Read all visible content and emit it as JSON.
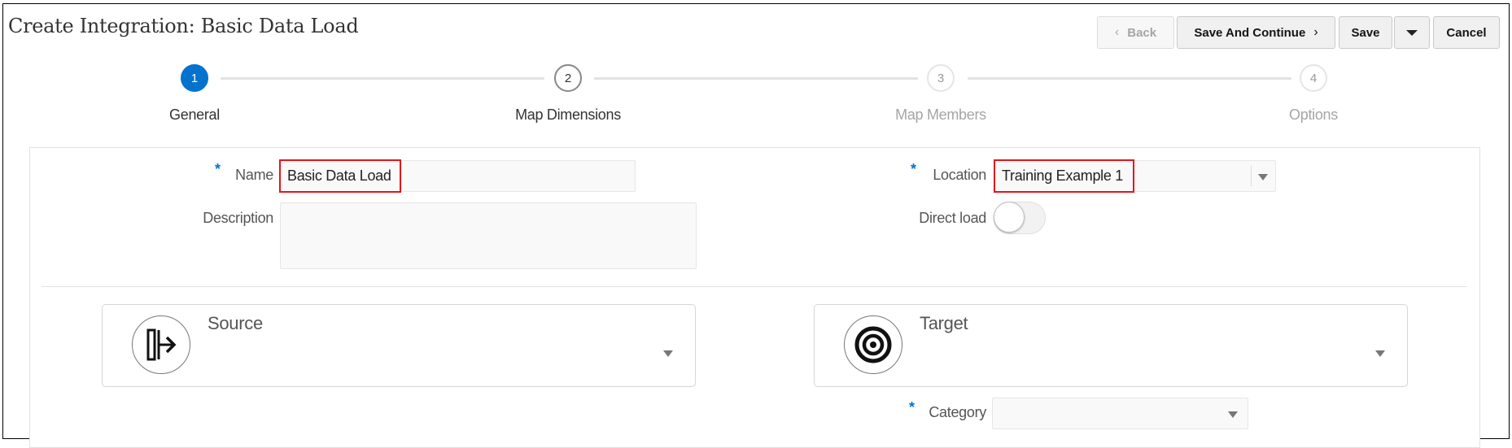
{
  "header": {
    "title": "Create Integration: Basic Data Load"
  },
  "toolbar": {
    "back_label": "Back",
    "back_chevron": "‹",
    "save_continue_label": "Save And Continue",
    "save_continue_chevron": "›",
    "save_label": "Save",
    "cancel_label": "Cancel"
  },
  "train": {
    "steps": [
      {
        "number": "1",
        "label": "General",
        "state": "active"
      },
      {
        "number": "2",
        "label": "Map Dimensions",
        "state": "visited"
      },
      {
        "number": "3",
        "label": "Map Members",
        "state": "future"
      },
      {
        "number": "4",
        "label": "Options",
        "state": "future"
      }
    ]
  },
  "form": {
    "required_marker": "*",
    "name": {
      "label": "Name",
      "value": "Basic Data Load"
    },
    "description": {
      "label": "Description",
      "value": ""
    },
    "location": {
      "label": "Location",
      "value": "Training Example 1"
    },
    "direct_load": {
      "label": "Direct load",
      "on": false
    },
    "source": {
      "title": "Source",
      "value": ""
    },
    "target": {
      "title": "Target",
      "value": ""
    },
    "category": {
      "label": "Category",
      "value": ""
    }
  },
  "colors": {
    "accent": "#0572ce",
    "highlight": "#e3151a"
  }
}
